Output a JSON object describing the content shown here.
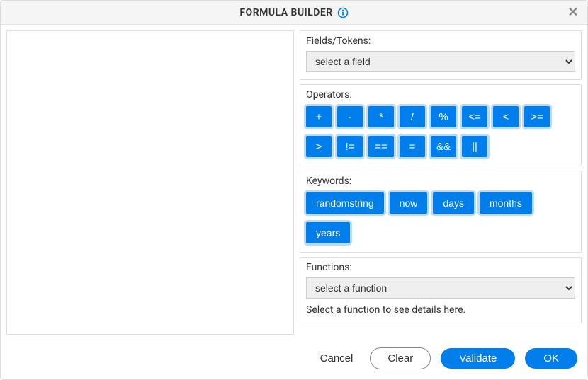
{
  "title": "FORMULA BUILDER",
  "editor_value": "",
  "fields": {
    "label": "Fields/Tokens:",
    "selected": "select a field"
  },
  "operators": {
    "label": "Operators:",
    "items": [
      "+",
      "-",
      "*",
      "/",
      "%",
      "<=",
      "<",
      ">=",
      ">",
      "!=",
      "==",
      "=",
      "&&",
      "||"
    ]
  },
  "keywords": {
    "label": "Keywords:",
    "items": [
      "randomstring",
      "now",
      "days",
      "months",
      "years"
    ]
  },
  "functions": {
    "label": "Functions:",
    "selected": "select a function",
    "hint": "Select a function to see details here."
  },
  "footer": {
    "cancel": "Cancel",
    "clear": "Clear",
    "validate": "Validate",
    "ok": "OK"
  }
}
